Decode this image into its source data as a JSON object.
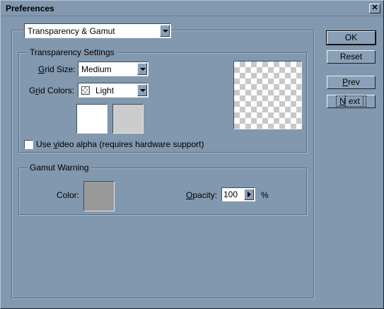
{
  "window": {
    "title": "Preferences"
  },
  "section_select": {
    "value": "Transparency & Gamut"
  },
  "transparency": {
    "group_label": "Transparency Settings",
    "grid_size_label_pre": "",
    "grid_size_label_u": "G",
    "grid_size_label_post": "rid Size:",
    "grid_size_value": "Medium",
    "grid_colors_label_pre": "G",
    "grid_colors_label_u": "r",
    "grid_colors_label_post": "id Colors:",
    "grid_colors_value": "Light",
    "swatch_1_color": "#ffffff",
    "swatch_2_color": "#cccccc",
    "video_alpha_pre": "Use ",
    "video_alpha_u": "v",
    "video_alpha_post": "ideo alpha (requires hardware support)"
  },
  "gamut": {
    "group_label": "Gamut Warning",
    "color_label": "Color:",
    "color_value": "#999999",
    "opacity_label_u": "O",
    "opacity_label_post": "pacity:",
    "opacity_value": "100",
    "opacity_unit": "%"
  },
  "buttons": {
    "ok": "OK",
    "reset": "Reset",
    "prev_u": "P",
    "prev_post": "rev",
    "next_u": "N",
    "next_post": "ext"
  }
}
